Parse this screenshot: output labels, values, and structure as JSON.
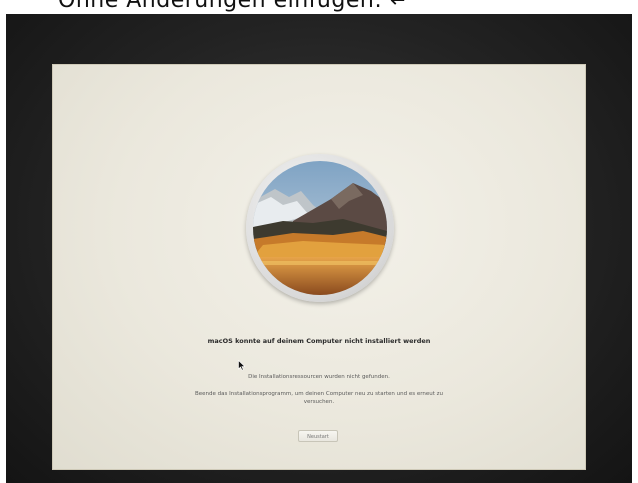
{
  "caption": {
    "text": "Ohne Änderungen einfügen: ↵"
  },
  "installer": {
    "title": "macOS konnte auf deinem Computer nicht installiert werden",
    "message_primary": "Die Installationsressourcen wurden nicht gefunden.",
    "message_secondary": "Beende das Installationsprogramm, um deinen Computer neu zu starten und es erneut zu versuchen.",
    "restart_label": "Neustart"
  },
  "icons": {
    "logo": "macos-high-sierra-logo-icon",
    "cursor": "mouse-pointer-icon"
  }
}
